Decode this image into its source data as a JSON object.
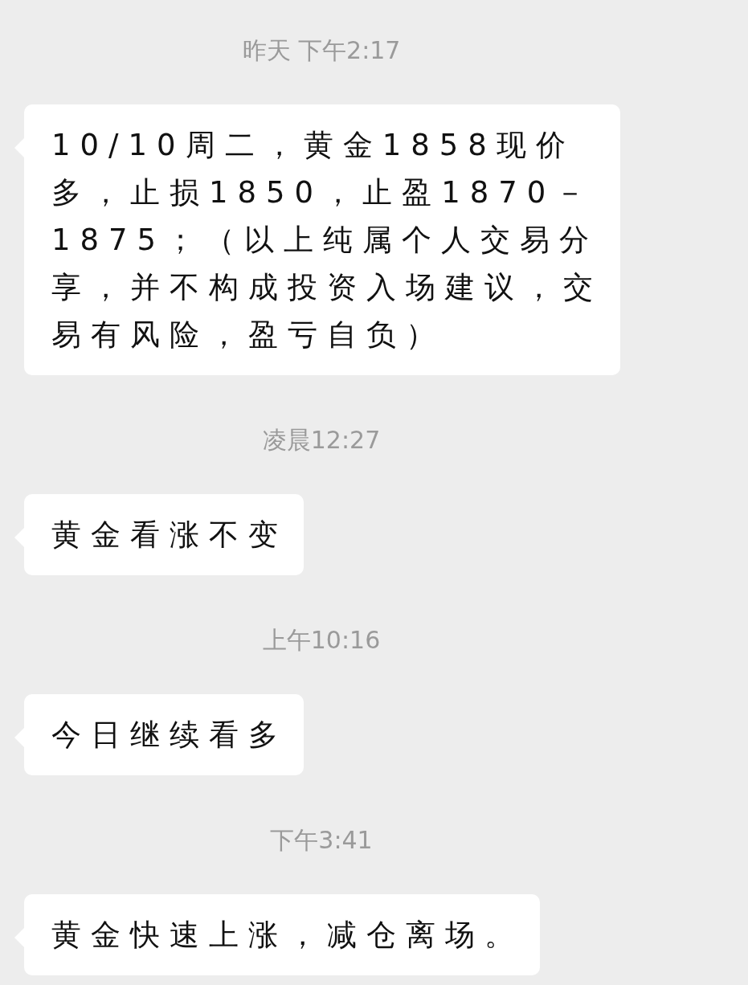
{
  "messages": [
    {
      "kind": "time",
      "text": "昨天 下午2:17"
    },
    {
      "kind": "bubble",
      "text": "10/10周二，黄金1858现价多，止损1850，止盈1870－1875；（以上纯属个人交易分享，并不构成投资入场建议，交易有风险，盈亏自负）"
    },
    {
      "kind": "time",
      "text": "凌晨12:27"
    },
    {
      "kind": "bubble",
      "text": "黄金看涨不变"
    },
    {
      "kind": "time",
      "text": "上午10:16"
    },
    {
      "kind": "bubble",
      "text": "今日继续看多"
    },
    {
      "kind": "time",
      "text": "下午3:41"
    },
    {
      "kind": "bubble",
      "text": "黄金快速上涨，减仓离场。"
    }
  ]
}
